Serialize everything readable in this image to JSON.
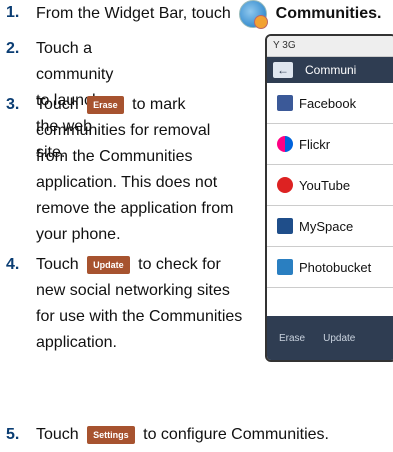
{
  "steps": [
    {
      "num": "1.",
      "a": "From the Widget Bar, touch",
      "b": "Communities."
    },
    {
      "num": "2.",
      "lines": [
        "Touch a community to launch",
        "the web site."
      ]
    },
    {
      "num": "3.",
      "a": "Touch",
      "btn": "Erase",
      "b": "to mark",
      "lines": [
        "communities for removal",
        "from the Communities",
        "application. This does not",
        "remove the application from",
        "your phone."
      ]
    },
    {
      "num": "4.",
      "a": "Touch",
      "btn": "Update",
      "b": "to check for",
      "lines": [
        "new social networking sites",
        "for use with the Communities",
        "application."
      ]
    },
    {
      "num": "5.",
      "a": "Touch",
      "btn": "Settings",
      "b": "to configure Communities."
    }
  ],
  "phone": {
    "status": "Y 3G",
    "title": "Communi",
    "items": [
      "Facebook",
      "Flickr",
      "YouTube",
      "MySpace",
      "Photobucket"
    ],
    "erase": "Erase",
    "update": "Update"
  }
}
